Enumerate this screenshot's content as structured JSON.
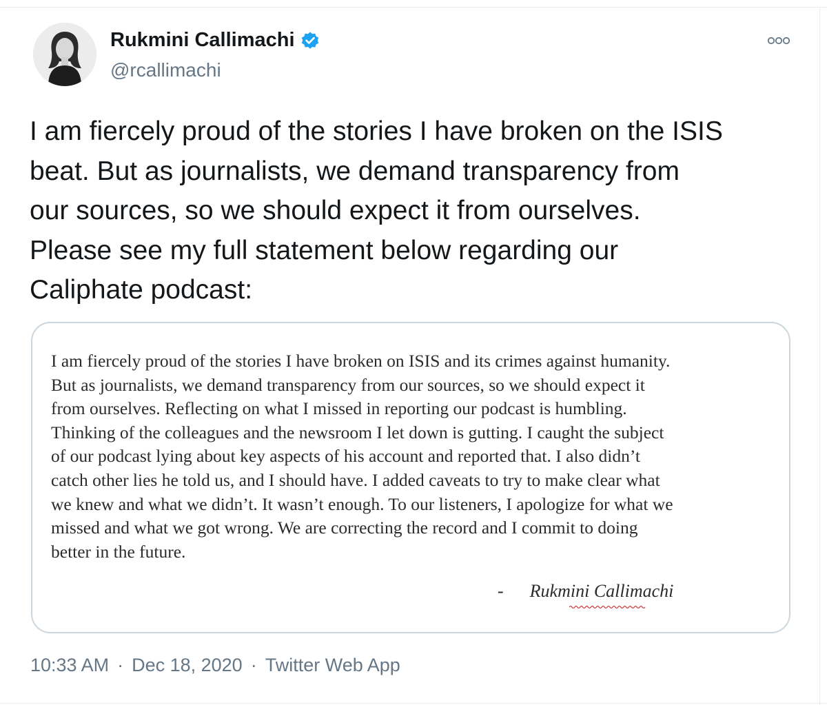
{
  "author": {
    "display_name": "Rukmini Callimachi",
    "handle": "@rcallimachi",
    "verified": true,
    "avatar_icon": "profile-photo"
  },
  "tweet": {
    "text_lines": [
      "I am fiercely proud of the stories I have broken on the ISIS",
      "beat. But as journalists, we demand transparency from",
      "our sources, so we should expect it from ourselves.",
      "Please see my full statement below regarding our",
      "Caliphate podcast:"
    ]
  },
  "attached_image": {
    "statement_lines": [
      "I am fiercely proud of the stories I have broken on ISIS and its crimes against humanity.",
      "But as journalists, we demand transparency from our sources, so we should expect it",
      "from ourselves. Reflecting on what I missed in reporting our podcast is humbling.",
      "Thinking of the colleagues and the newsroom I let down is gutting. I caught the subject",
      "of our podcast lying about key aspects of his account and reported that. I also didn’t",
      "catch other lies he told us, and I should have. I added caveats to try to make clear what",
      "we knew and what we didn’t. It wasn’t enough. To our listeners, I apologize for what we",
      "missed and what we got wrong. We are correcting the record and I commit to doing",
      "better in the future."
    ],
    "signature_dash": "-",
    "signature_name": "Rukmini Callimachi"
  },
  "meta": {
    "time": "10:33 AM",
    "separator": "·",
    "date": "Dec 18, 2020",
    "source": "Twitter Web App"
  },
  "colors": {
    "verified_blue": "#1da1f2",
    "secondary_text": "#657786",
    "border": "#ccd6dd"
  },
  "icons": {
    "more": "more-options-icon",
    "verified": "verified-badge-icon"
  }
}
